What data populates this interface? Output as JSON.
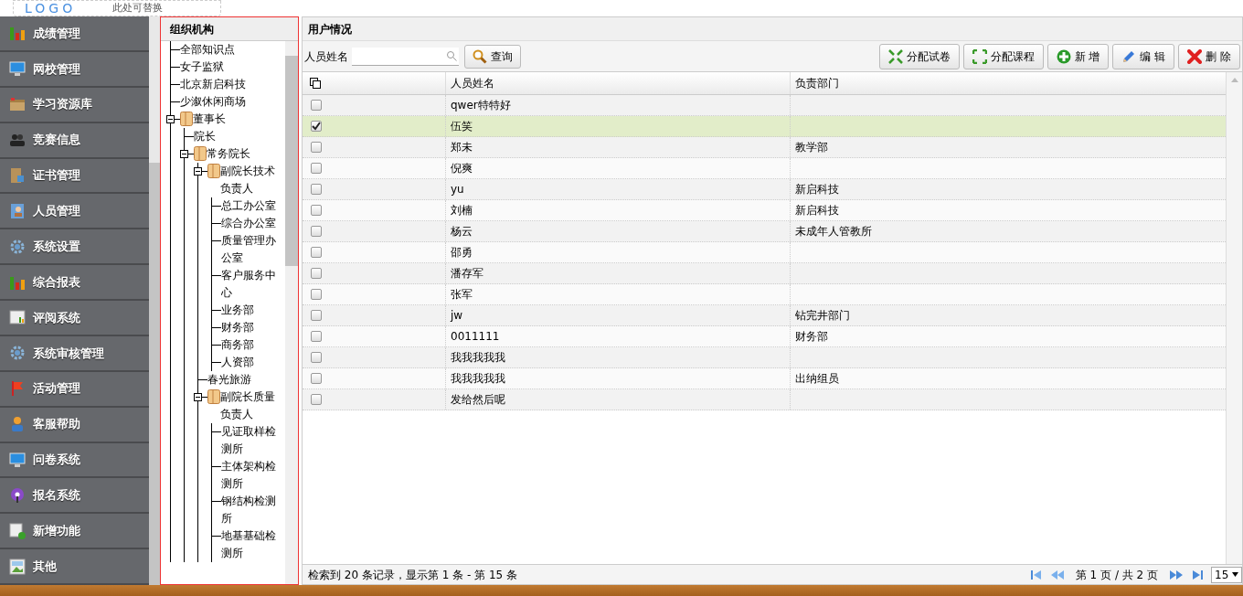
{
  "header": {
    "logo": "LOGO",
    "note": "此处可替换"
  },
  "sidebar": {
    "items": [
      {
        "label": "成绩管理",
        "kind": "bars"
      },
      {
        "label": "网校管理",
        "kind": "monitor"
      },
      {
        "label": "学习资源库",
        "kind": "box"
      },
      {
        "label": "竞赛信息",
        "kind": "users"
      },
      {
        "label": "证书管理",
        "kind": "book"
      },
      {
        "label": "人员管理",
        "kind": "contact"
      },
      {
        "label": "系统设置",
        "kind": "gear"
      },
      {
        "label": "综合报表",
        "kind": "bars"
      },
      {
        "label": "评阅系统",
        "kind": "report"
      },
      {
        "label": "系统审核管理",
        "kind": "gear"
      },
      {
        "label": "活动管理",
        "kind": "flag"
      },
      {
        "label": "客服帮助",
        "kind": "person"
      },
      {
        "label": "问卷系统",
        "kind": "monitor"
      },
      {
        "label": "报名系统",
        "kind": "podcast"
      },
      {
        "label": "新增功能",
        "kind": "add"
      },
      {
        "label": "其他",
        "kind": "image"
      }
    ]
  },
  "tree": {
    "title": "组织机构",
    "nodes": [
      {
        "label": "全部知识点"
      },
      {
        "label": "女子监狱"
      },
      {
        "label": "北京新启科技"
      },
      {
        "label": "少溆休闲商场"
      },
      {
        "label": "董事长",
        "expanded": true,
        "children": [
          {
            "label": "院长"
          },
          {
            "label": "常务院长",
            "expanded": true,
            "children": [
              {
                "label": "副院长技术负责人",
                "expanded": true,
                "children": [
                  {
                    "label": "总工办公室"
                  },
                  {
                    "label": "综合办公室"
                  },
                  {
                    "label": "质量管理办公室"
                  },
                  {
                    "label": "客户服务中心"
                  },
                  {
                    "label": "业务部"
                  },
                  {
                    "label": "财务部"
                  },
                  {
                    "label": "商务部"
                  },
                  {
                    "label": "人资部"
                  }
                ]
              },
              {
                "label": "春光旅游"
              },
              {
                "label": "副院长质量负责人",
                "expanded": true,
                "children": [
                  {
                    "label": "见证取样检测所"
                  },
                  {
                    "label": "主体架构检测所"
                  },
                  {
                    "label": "钢结构检测所"
                  },
                  {
                    "label": "地基基础检测所"
                  }
                ]
              }
            ]
          }
        ]
      }
    ]
  },
  "users": {
    "title": "用户情况",
    "search": {
      "label": "人员姓名",
      "button": "查询"
    },
    "toolbar": [
      {
        "label": "分配试卷",
        "kind": "assign-paper"
      },
      {
        "label": "分配课程",
        "kind": "assign-course"
      },
      {
        "label": "新 增",
        "kind": "add"
      },
      {
        "label": "编 辑",
        "kind": "edit"
      },
      {
        "label": "删 除",
        "kind": "delete"
      }
    ],
    "columns": [
      "人员姓名",
      "负责部门"
    ],
    "rows": [
      {
        "selected": false,
        "name": "qwer特特好",
        "department": ""
      },
      {
        "selected": true,
        "name": "伍笑",
        "department": ""
      },
      {
        "selected": false,
        "name": "郑未",
        "department": "教学部"
      },
      {
        "selected": false,
        "name": "倪爽",
        "department": ""
      },
      {
        "selected": false,
        "name": "yu",
        "department": "新启科技"
      },
      {
        "selected": false,
        "name": "刘楠",
        "department": "新启科技"
      },
      {
        "selected": false,
        "name": "杨云",
        "department": "未成年人管教所"
      },
      {
        "selected": false,
        "name": "邵勇",
        "department": ""
      },
      {
        "selected": false,
        "name": "潘存军",
        "department": ""
      },
      {
        "selected": false,
        "name": "张军",
        "department": ""
      },
      {
        "selected": false,
        "name": "jw",
        "department": "钻完井部门"
      },
      {
        "selected": false,
        "name": "0011111",
        "department": "财务部"
      },
      {
        "selected": false,
        "name": "我我我我我",
        "department": ""
      },
      {
        "selected": false,
        "name": "我我我我我",
        "department": "出纳组员"
      },
      {
        "selected": false,
        "name": "发给然后呢",
        "department": ""
      }
    ],
    "footer": {
      "summary": "检索到 20 条记录，显示第 1 条 - 第 15 条",
      "page": "第 1 页 / 共 2 页",
      "page_size": "15"
    }
  }
}
